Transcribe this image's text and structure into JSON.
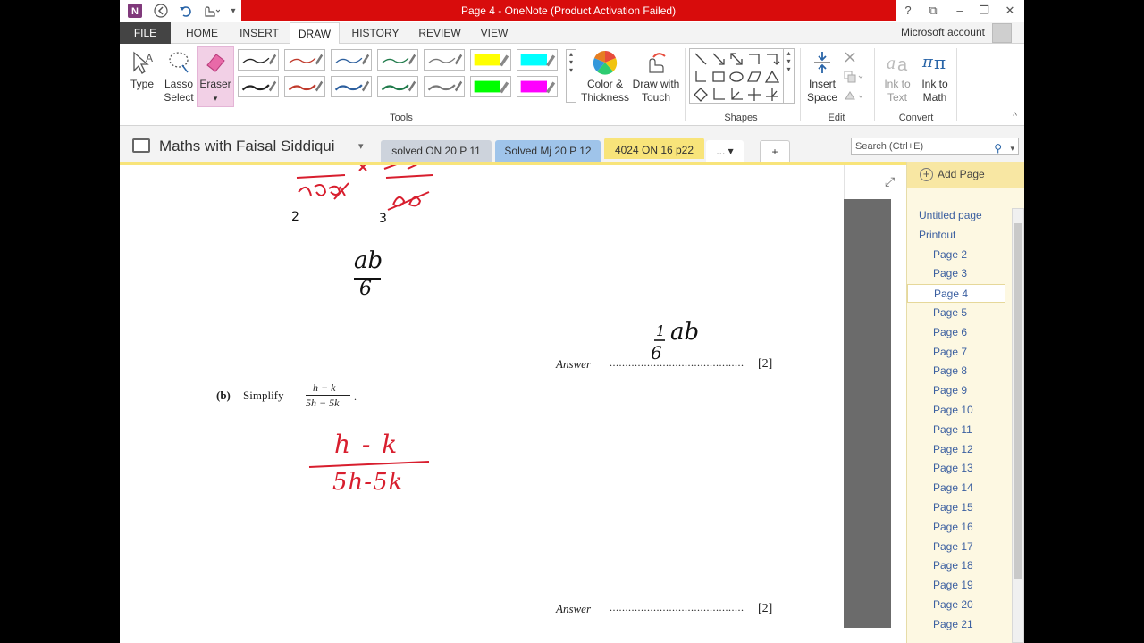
{
  "titlebar": {
    "title": "Page 4 - OneNote (Product Activation Failed)",
    "help": "?",
    "restore_mode": "⧉",
    "minimize": "–",
    "maximize": "❐",
    "close": "✕"
  },
  "tabs": {
    "file": "FILE",
    "home": "HOME",
    "insert": "INSERT",
    "draw": "DRAW",
    "history": "HISTORY",
    "review": "REVIEW",
    "view": "VIEW",
    "account": "Microsoft account"
  },
  "ribbon": {
    "type": "Type",
    "lasso_line1": "Lasso",
    "lasso_line2": "Select",
    "eraser": "Eraser",
    "eraser_caret": "▾",
    "color_line1": "Color &",
    "color_line2": "Thickness",
    "touch_line1": "Draw with",
    "touch_line2": "Touch",
    "tools_label": "Tools",
    "shapes_label": "Shapes",
    "insert_space_line1": "Insert",
    "insert_space_line2": "Space",
    "edit_label": "Edit",
    "ink_text_line1": "Ink to",
    "ink_text_line2": "Text",
    "ink_math_line1": "Ink to",
    "ink_math_line2": "Math",
    "convert_label": "Convert",
    "collapse": "^",
    "pen_colors": [
      "#222222",
      "#c0392b",
      "#2c5f9e",
      "#1f7a4a",
      "#777777",
      "#ffff00",
      "#00ffff",
      "#222222",
      "#c0392b",
      "#2c5f9e",
      "#1f7a4a",
      "#777777",
      "#00ff00",
      "#ff00ff"
    ]
  },
  "notebook": {
    "title": "Maths with Faisal Siddiqui",
    "caret": "▾",
    "sections": [
      {
        "label": "solved ON 20 P 11",
        "color": "#cdd3dc"
      },
      {
        "label": "Solved Mj 20 P 12",
        "color": "#9fc4ea"
      },
      {
        "label": "4024 ON 16 p22",
        "color": "#f8e47a"
      },
      {
        "label": "... ▾",
        "color": "#ffffff"
      },
      {
        "label": "+",
        "color": "#ffffff"
      }
    ],
    "search_placeholder": "Search (Ctrl+E)",
    "search_icon": "⚲",
    "search_caret": "▾"
  },
  "content": {
    "answer1_label": "Answer",
    "answer1_dots": "...........................................",
    "answer1_mark": "[2]",
    "part_b": "(b)",
    "simplify": "Simplify",
    "frac_num": "h − k",
    "frac_den": "5h − 5k",
    "frac_dot": ".",
    "answer2_label": "Answer",
    "answer2_dots": "...........................................",
    "answer2_mark": "[2]",
    "ink_top_num1": "2",
    "ink_top_num2": "3",
    "ink_ab": "ab",
    "ink_6": "6",
    "ink_ans_1": "1",
    "ink_ans_ab": "ab",
    "ink_ans_6": "6",
    "ink_hk": "h - k",
    "ink_5h5k": "5h-5k"
  },
  "pagelist": {
    "add_page": "Add Page",
    "add_icon": "+",
    "expand_icon": "⤢",
    "pages": [
      {
        "label": "Untitled page",
        "level": 0
      },
      {
        "label": "Printout",
        "level": 0
      },
      {
        "label": "Page 2",
        "level": 1
      },
      {
        "label": "Page 3",
        "level": 1
      },
      {
        "label": "Page 4",
        "level": 1,
        "active": true
      },
      {
        "label": "Page 5",
        "level": 1
      },
      {
        "label": "Page 6",
        "level": 1
      },
      {
        "label": "Page 7",
        "level": 1
      },
      {
        "label": "Page 8",
        "level": 1
      },
      {
        "label": "Page 9",
        "level": 1
      },
      {
        "label": "Page 10",
        "level": 1
      },
      {
        "label": "Page 11",
        "level": 1
      },
      {
        "label": "Page 12",
        "level": 1
      },
      {
        "label": "Page 13",
        "level": 1
      },
      {
        "label": "Page 14",
        "level": 1
      },
      {
        "label": "Page 15",
        "level": 1
      },
      {
        "label": "Page 16",
        "level": 1
      },
      {
        "label": "Page 17",
        "level": 1
      },
      {
        "label": "Page 18",
        "level": 1
      },
      {
        "label": "Page 19",
        "level": 1
      },
      {
        "label": "Page 20",
        "level": 1
      },
      {
        "label": "Page 21",
        "level": 1
      }
    ]
  }
}
